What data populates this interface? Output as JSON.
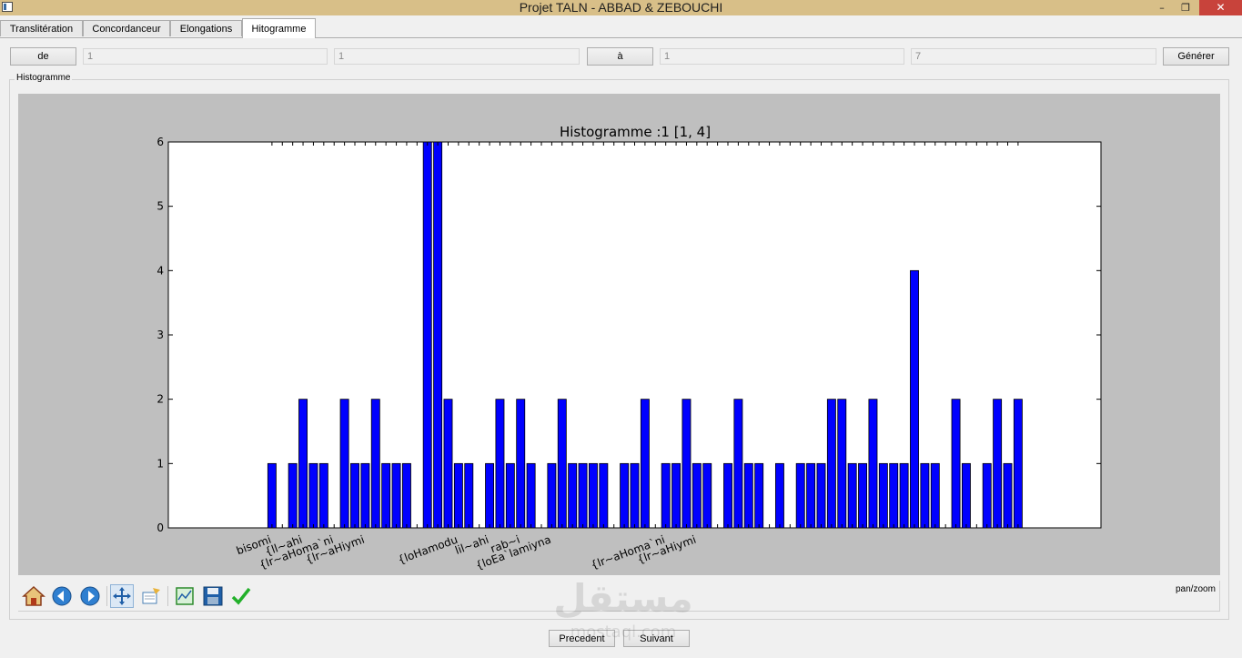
{
  "window": {
    "title": "Projet TALN - ABBAD & ZEBOUCHI",
    "minimize_glyph": "–",
    "maximize_glyph": "❐",
    "close_glyph": "✕"
  },
  "tabs": [
    {
      "label": "Translitération",
      "active": false
    },
    {
      "label": "Concordanceur",
      "active": false
    },
    {
      "label": "Elongations",
      "active": false
    },
    {
      "label": "Hitogramme",
      "active": true
    }
  ],
  "range": {
    "from_label": "de",
    "from_surah": "1",
    "from_ayah": "1",
    "to_label": "à",
    "to_surah": "1",
    "to_ayah": "7",
    "generate_label": "Générer"
  },
  "group_label": "Histogramme",
  "chart_data": {
    "type": "bar",
    "title": "Histogramme :1 [1, 4]",
    "xlabel": "",
    "ylabel": "",
    "ylim": [
      0,
      6
    ],
    "xlim": [
      -10,
      80
    ],
    "yticks": [
      0,
      1,
      2,
      3,
      4,
      5,
      6
    ],
    "grid": false,
    "bar_color": "#0000ff",
    "values": [
      1,
      0,
      1,
      2,
      1,
      1,
      0,
      2,
      1,
      1,
      2,
      1,
      1,
      1,
      0,
      6,
      6,
      2,
      1,
      1,
      0,
      1,
      2,
      1,
      2,
      1,
      0,
      1,
      2,
      1,
      1,
      1,
      1,
      0,
      1,
      1,
      2,
      0,
      1,
      1,
      2,
      1,
      1,
      0,
      1,
      2,
      1,
      1,
      0,
      1,
      0,
      1,
      1,
      1,
      2,
      2,
      1,
      1,
      2,
      1,
      1,
      1,
      4,
      1,
      1,
      0,
      2,
      1,
      0,
      1,
      2,
      1,
      2
    ],
    "tick_labels": [
      {
        "label": "bisomi",
        "x": 0
      },
      {
        "label": "{ll~ahi",
        "x": 3
      },
      {
        "label": "{lr~aHoma`ni",
        "x": 6
      },
      {
        "label": "{lr~aHiymi",
        "x": 9
      },
      {
        "label": "{loHamodu",
        "x": 18
      },
      {
        "label": "lil~ahi",
        "x": 21
      },
      {
        "label": "rab~i",
        "x": 24
      },
      {
        "label": "{loEa`lamiyna",
        "x": 27
      },
      {
        "label": "{lr~aHoma`ni",
        "x": 38
      },
      {
        "label": "{lr~aHiymi",
        "x": 41
      }
    ]
  },
  "mpl_toolbar": {
    "icons": [
      "home-icon",
      "back-icon",
      "forward-icon",
      "pan-icon",
      "zoom-icon",
      "subplots-icon",
      "save-icon",
      "edit-icon"
    ],
    "mode": "pan/zoom"
  },
  "nav": {
    "prev_label": "Precedent",
    "next_label": "Suivant"
  },
  "watermark": {
    "text": "مستقل",
    "sub": "mostaql.com"
  }
}
